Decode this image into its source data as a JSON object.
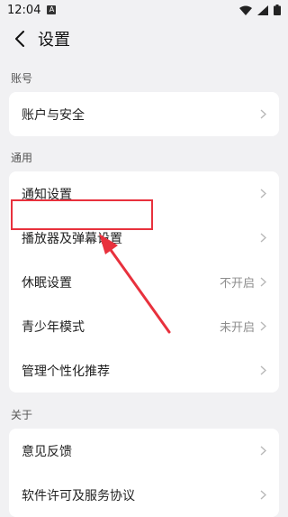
{
  "status": {
    "time": "12:04",
    "badge": "A"
  },
  "header": {
    "title": "设置"
  },
  "sections": {
    "account": {
      "label": "账号",
      "items": [
        {
          "label": "账户与安全"
        }
      ]
    },
    "general": {
      "label": "通用",
      "items": [
        {
          "label": "通知设置",
          "value": ""
        },
        {
          "label": "播放器及弹幕设置",
          "value": ""
        },
        {
          "label": "休眠设置",
          "value": "不开启"
        },
        {
          "label": "青少年模式",
          "value": "未开启"
        },
        {
          "label": "管理个性化推荐",
          "value": ""
        }
      ]
    },
    "about": {
      "label": "关于",
      "items": [
        {
          "label": "意见反馈"
        },
        {
          "label": "软件许可及服务协议"
        }
      ]
    }
  },
  "colors": {
    "highlight": "#e8313d",
    "background": "#f1f1f3",
    "card": "#ffffff"
  },
  "icons": [
    "back-arrow-icon",
    "chevron-right-icon",
    "wifi-icon",
    "signal-icon",
    "battery-icon"
  ]
}
